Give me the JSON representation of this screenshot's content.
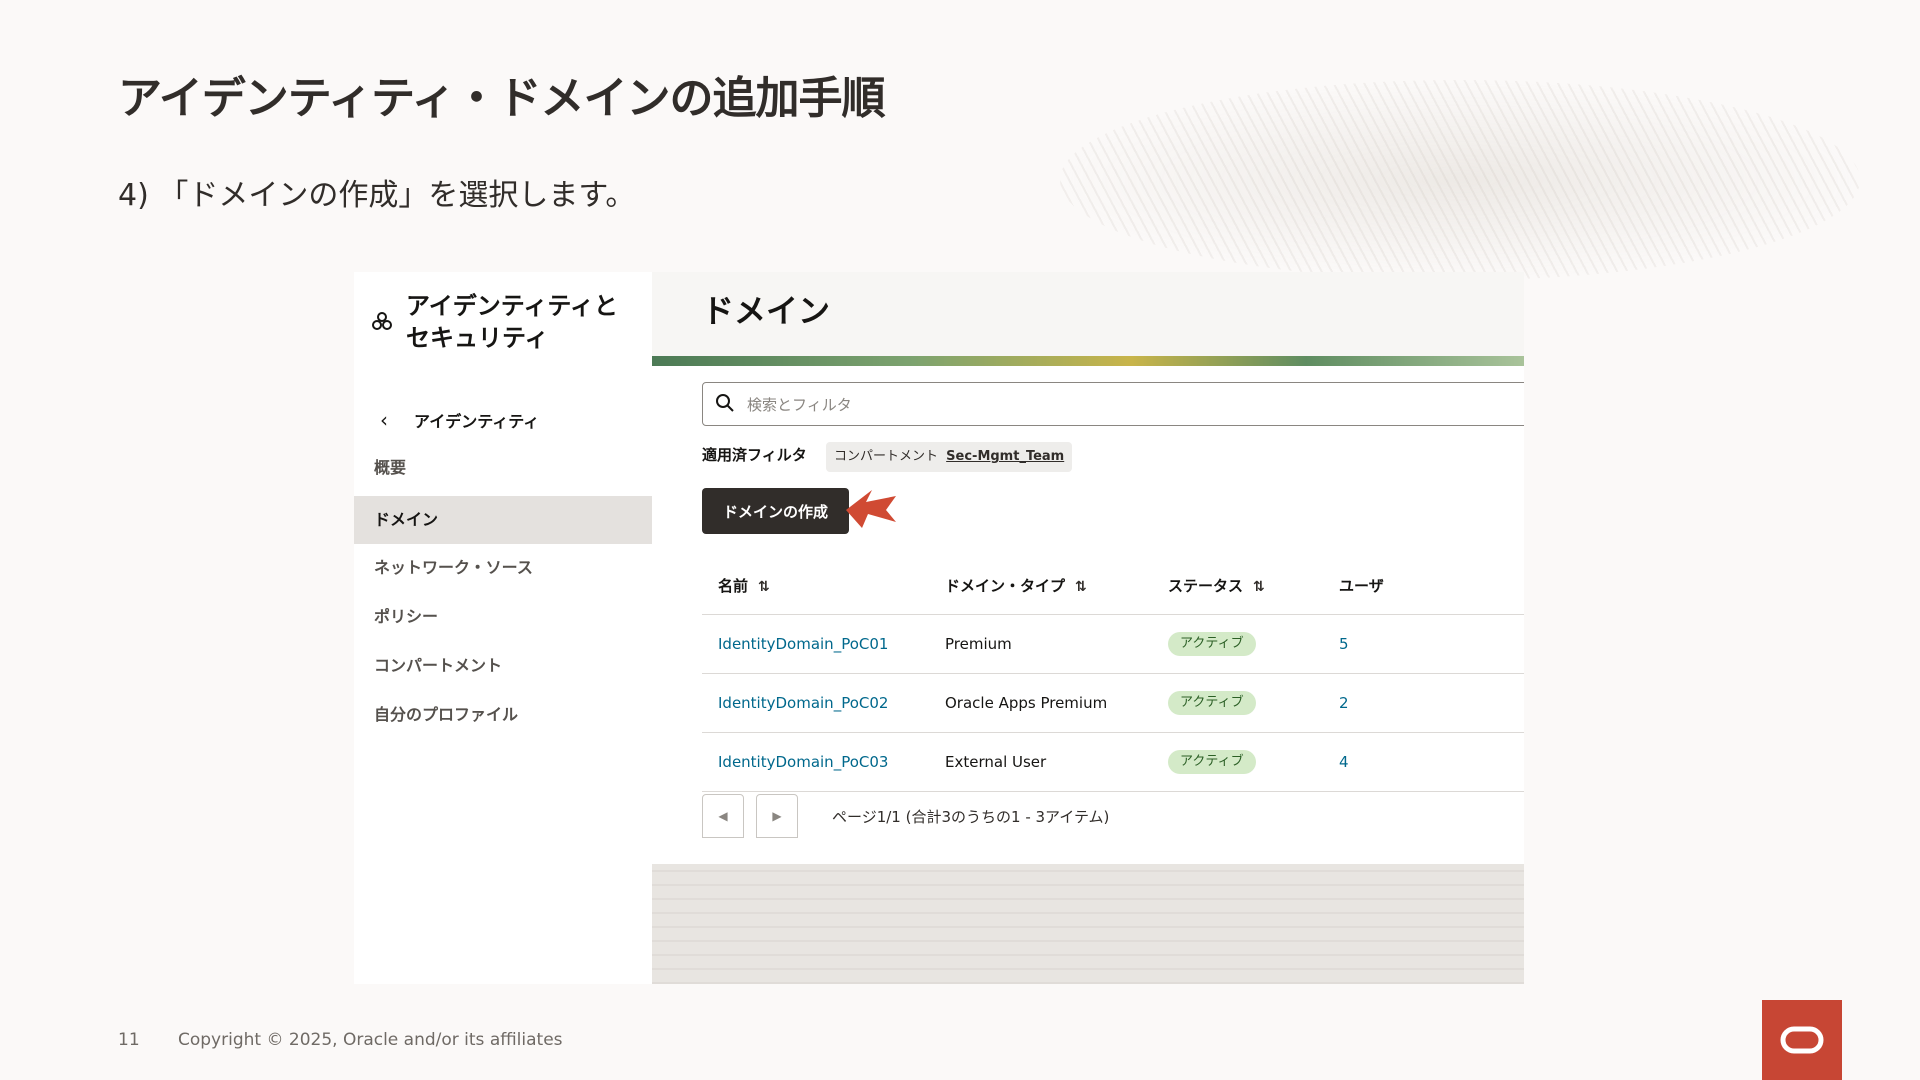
{
  "slide": {
    "title": "アイデンティティ・ドメインの追加手順",
    "subtitle": "4) 「ドメインの作成」を選択します。",
    "page_number": "11",
    "copyright": "Copyright © 2025, Oracle and/or its affiliates"
  },
  "sidebar": {
    "title": "アイデンティティとセキュリティ",
    "back_label": "アイデンティティ",
    "items": [
      {
        "label": "概要",
        "active": false
      },
      {
        "label": "ドメイン",
        "active": true
      },
      {
        "label": "ネットワーク・ソース",
        "active": false
      },
      {
        "label": "ポリシー",
        "active": false
      },
      {
        "label": "コンパートメント",
        "active": false
      },
      {
        "label": "自分のプロファイル",
        "active": false
      }
    ]
  },
  "main": {
    "title": "ドメイン",
    "search": {
      "placeholder": "検索とフィルタ",
      "value": ""
    },
    "applied_filters_label": "適用済フィルタ",
    "filter_chip": {
      "key": "コンパートメント",
      "value": "Sec-Mgmt_Team"
    },
    "create_button_label": "ドメインの作成"
  },
  "table": {
    "columns": [
      "名前",
      "ドメイン・タイプ",
      "ステータス",
      "ユーザ"
    ],
    "rows": [
      {
        "name": "IdentityDomain_PoC01",
        "type": "Premium",
        "status": "アクティブ",
        "users": "5"
      },
      {
        "name": "IdentityDomain_PoC02",
        "type": "Oracle Apps Premium",
        "status": "アクティブ",
        "users": "2"
      },
      {
        "name": "IdentityDomain_PoC03",
        "type": "External User",
        "status": "アクティブ",
        "users": "4"
      }
    ]
  },
  "pagination": {
    "text": "ページ1/1 (合計3のうちの1 - 3アイテム)"
  },
  "colors": {
    "accent_arrow": "#d04a33",
    "status_badge_bg": "#d4eac8",
    "link": "#00688c",
    "oracle_red": "#c74634"
  }
}
